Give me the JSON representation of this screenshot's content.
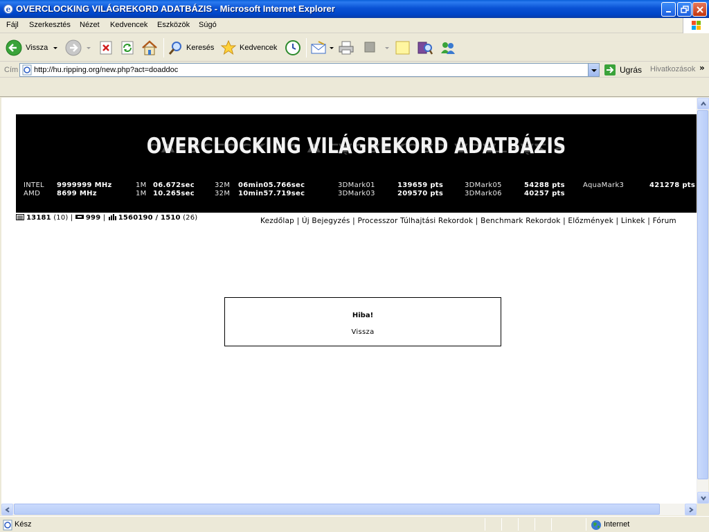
{
  "window": {
    "title": "OVERCLOCKING VILÁGREKORD ADATBÁZIS - Microsoft Internet Explorer"
  },
  "menu": [
    "Fájl",
    "Szerkesztés",
    "Nézet",
    "Kedvencek",
    "Eszközök",
    "Súgó"
  ],
  "toolbar": {
    "back_label": "Vissza",
    "search_label": "Keresés",
    "favorites_label": "Kedvencek"
  },
  "address": {
    "label": "Cím",
    "url": "http://hu.ripping.org/new.php?act=doaddoc",
    "go_label": "Ugrás",
    "links_label": "Hivatkozások",
    "chevron": "»"
  },
  "banner": {
    "title": "OVERCLOCKING VILÁGREKORD ADATBÁZIS",
    "rows": [
      {
        "brand": "INTEL",
        "freq": "9999999 MHz",
        "pi1_label": "1M",
        "pi1_value": "06.672sec",
        "pi32_label": "32M",
        "pi32_value": "06min05.766sec",
        "bench1_label": "3DMark01",
        "bench1_value": "139659 pts",
        "bench2_label": "3DMark05",
        "bench2_value": "54288 pts",
        "bench3_label": "AquaMark3",
        "bench3_value": "421278 pts"
      },
      {
        "brand": "AMD",
        "freq": "8699 MHz",
        "pi1_label": "1M",
        "pi1_value": "10.265sec",
        "pi32_label": "32M",
        "pi32_value": "10min57.719sec",
        "bench1_label": "3DMark03",
        "bench1_value": "209570 pts",
        "bench2_label": "3DMark06",
        "bench2_value": "40257 pts"
      }
    ]
  },
  "stats": {
    "entries": "13181",
    "entries_new": "(10)",
    "flags": "999",
    "records": "1560190 / 1510",
    "records_new": "(26)",
    "sep": "|"
  },
  "nav": [
    "Kezdőlap",
    "Új Bejegyzés",
    "Processzor Túlhajtási Rekordok",
    "Benchmark Rekordok",
    "Előzmények",
    "Linkek",
    "Fórum"
  ],
  "error": {
    "title": "Hiba!",
    "back": "Vissza"
  },
  "status": {
    "text": "Kész",
    "zone": "Internet"
  },
  "colors": {
    "titlebar": "#0a52d4",
    "banner_bg": "#000000",
    "page_bg": "#ffffff",
    "chrome": "#ece9d8"
  }
}
